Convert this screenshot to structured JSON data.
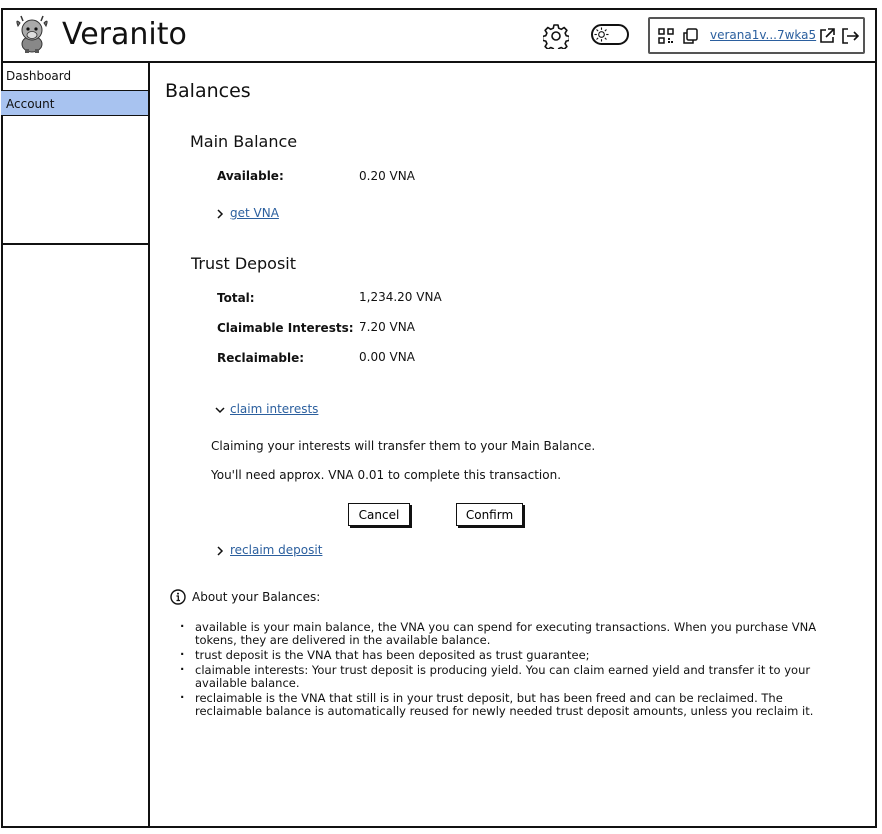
{
  "app": {
    "title": "Veranito"
  },
  "header": {
    "address": "verana1v...7wka5"
  },
  "sidebar": {
    "items": [
      {
        "label": "Dashboard",
        "active": false
      },
      {
        "label": "Account",
        "active": true
      }
    ]
  },
  "main": {
    "title": "Balances",
    "main_balance": {
      "heading": "Main Balance",
      "available_label": "Available:",
      "available_value": "0.20 VNA",
      "get_vna_link": "get VNA"
    },
    "trust_deposit": {
      "heading": "Trust Deposit",
      "total_label": "Total:",
      "total_value": "1,234.20 VNA",
      "claimable_label": "Claimable Interests:",
      "claimable_value": "7.20 VNA",
      "reclaimable_label": "Reclaimable:",
      "reclaimable_value": "0.00 VNA",
      "claim_link": "claim interests",
      "claim_message": "Claiming your interests will transfer them to your Main Balance.",
      "fee_message": "You'll need approx. VNA 0.01 to complete this transaction.",
      "cancel_label": "Cancel",
      "confirm_label": "Confirm",
      "reclaim_link": "reclaim deposit"
    },
    "about": {
      "title": "About your Balances:",
      "bullets": [
        "available is your main balance, the VNA you can spend for executing transactions. When you purchase VNA tokens, they are delivered in the available balance.",
        "trust deposit is the VNA that has been deposited as trust guarantee;",
        "claimable interests: Your trust deposit is producing yield. You can claim earned yield and transfer it to your available balance.",
        "reclaimable is the VNA that still is in your trust deposit, but has been freed and can be reclaimed. The reclaimable balance is automatically reused for newly needed trust deposit amounts, unless you reclaim it."
      ]
    }
  },
  "colors": {
    "link": "#2b5f9e",
    "active_nav": "#a8c3f0"
  }
}
